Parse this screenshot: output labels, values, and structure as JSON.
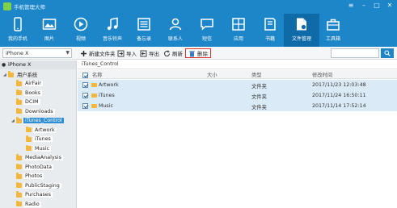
{
  "app": {
    "title": "手机管理大师"
  },
  "nav": {
    "items": [
      {
        "label": "我的手机",
        "icon": "phone-icon"
      },
      {
        "label": "图片",
        "icon": "image-icon"
      },
      {
        "label": "视频",
        "icon": "video-icon"
      },
      {
        "label": "音乐铃声",
        "icon": "music-icon"
      },
      {
        "label": "备忘录",
        "icon": "notes-icon"
      },
      {
        "label": "联系人",
        "icon": "contacts-icon"
      },
      {
        "label": "短信",
        "icon": "sms-icon"
      },
      {
        "label": "应用",
        "icon": "apps-icon"
      },
      {
        "label": "书籍",
        "icon": "book-icon"
      },
      {
        "label": "文件管理",
        "icon": "file-manager-icon"
      },
      {
        "label": "工具箱",
        "icon": "toolbox-icon"
      }
    ],
    "active": "文件管理"
  },
  "toolbar": {
    "device_selected": "iPhone X",
    "new_folder_label": "新建文件夹",
    "import_label": "导入",
    "export_label": "导出",
    "refresh_label": "刷新",
    "delete_label": "删除",
    "search_placeholder": ""
  },
  "tree": {
    "device": "iPhone X",
    "system_label": "用户系统",
    "nodes": [
      {
        "label": "AirFair",
        "level": 1
      },
      {
        "label": "Books",
        "level": 1
      },
      {
        "label": "DCIM",
        "level": 1
      },
      {
        "label": "Downloads",
        "level": 1
      },
      {
        "label": "iTunes_Control",
        "level": 1,
        "selected": true
      },
      {
        "label": "Artwork",
        "level": 2
      },
      {
        "label": "iTunes",
        "level": 2
      },
      {
        "label": "Music",
        "level": 2
      },
      {
        "label": "MediaAnalysis",
        "level": 1
      },
      {
        "label": "PhotoData",
        "level": 1
      },
      {
        "label": "Photos",
        "level": 1
      },
      {
        "label": "PublicStaging",
        "level": 1
      },
      {
        "label": "Purchases",
        "level": 1
      },
      {
        "label": "Radio",
        "level": 1
      }
    ]
  },
  "path": {
    "current": "iTunes_Control"
  },
  "list": {
    "columns": {
      "name": "名称",
      "size": "大小",
      "type": "类型",
      "modified": "修改时间"
    },
    "rows": [
      {
        "name": "Artwork",
        "size": "",
        "type": "文件夹",
        "modified": "2017/11/23 12:03:48"
      },
      {
        "name": "iTunes",
        "size": "",
        "type": "文件夹",
        "modified": "2017/11/24 16:50:11"
      },
      {
        "name": "Music",
        "size": "",
        "type": "文件夹",
        "modified": "2017/11/14 17:52:14"
      }
    ]
  },
  "colors": {
    "accent": "#1d86c8",
    "delete_highlight": "#e0312c",
    "folder": "#f4b73d"
  }
}
